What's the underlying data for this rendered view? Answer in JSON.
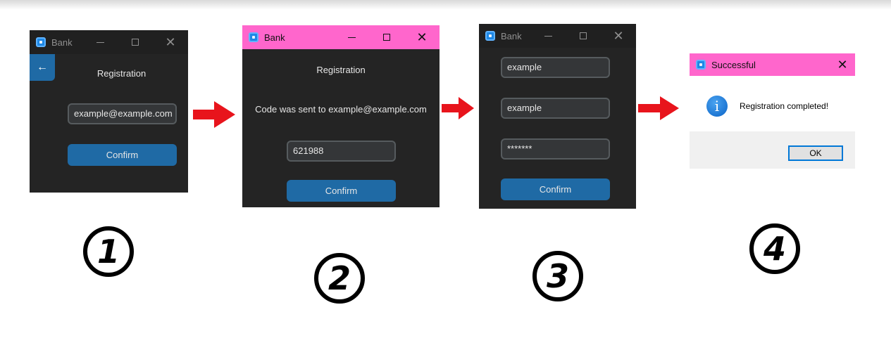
{
  "step1": {
    "window_title": "Bank",
    "back_icon": "←",
    "heading": "Registration",
    "email_value": "example@example.com",
    "confirm_label": "Confirm",
    "step_number": "1"
  },
  "step2": {
    "window_title": "Bank",
    "heading": "Registration",
    "info_text": "Code was sent to example@example.com",
    "code_value": "621988",
    "confirm_label": "Confirm",
    "step_number": "2"
  },
  "step3": {
    "window_title": "Bank",
    "field1_value": "example",
    "field2_value": "example",
    "password_value": "*******",
    "confirm_label": "Confirm",
    "step_number": "3"
  },
  "step4": {
    "dialog_title": "Successful",
    "info_icon": "i",
    "message": "Registration completed!",
    "ok_label": "OK",
    "step_number": "4"
  },
  "icons": {
    "close": "✕",
    "app_icon": "bank-app-icon",
    "arrow": "red-right-arrow-icon",
    "arrow_color": "#e8141c"
  },
  "colors": {
    "window_bg": "#242424",
    "button_blue": "#1f6aa5",
    "title_pink": "#ff66cc"
  }
}
